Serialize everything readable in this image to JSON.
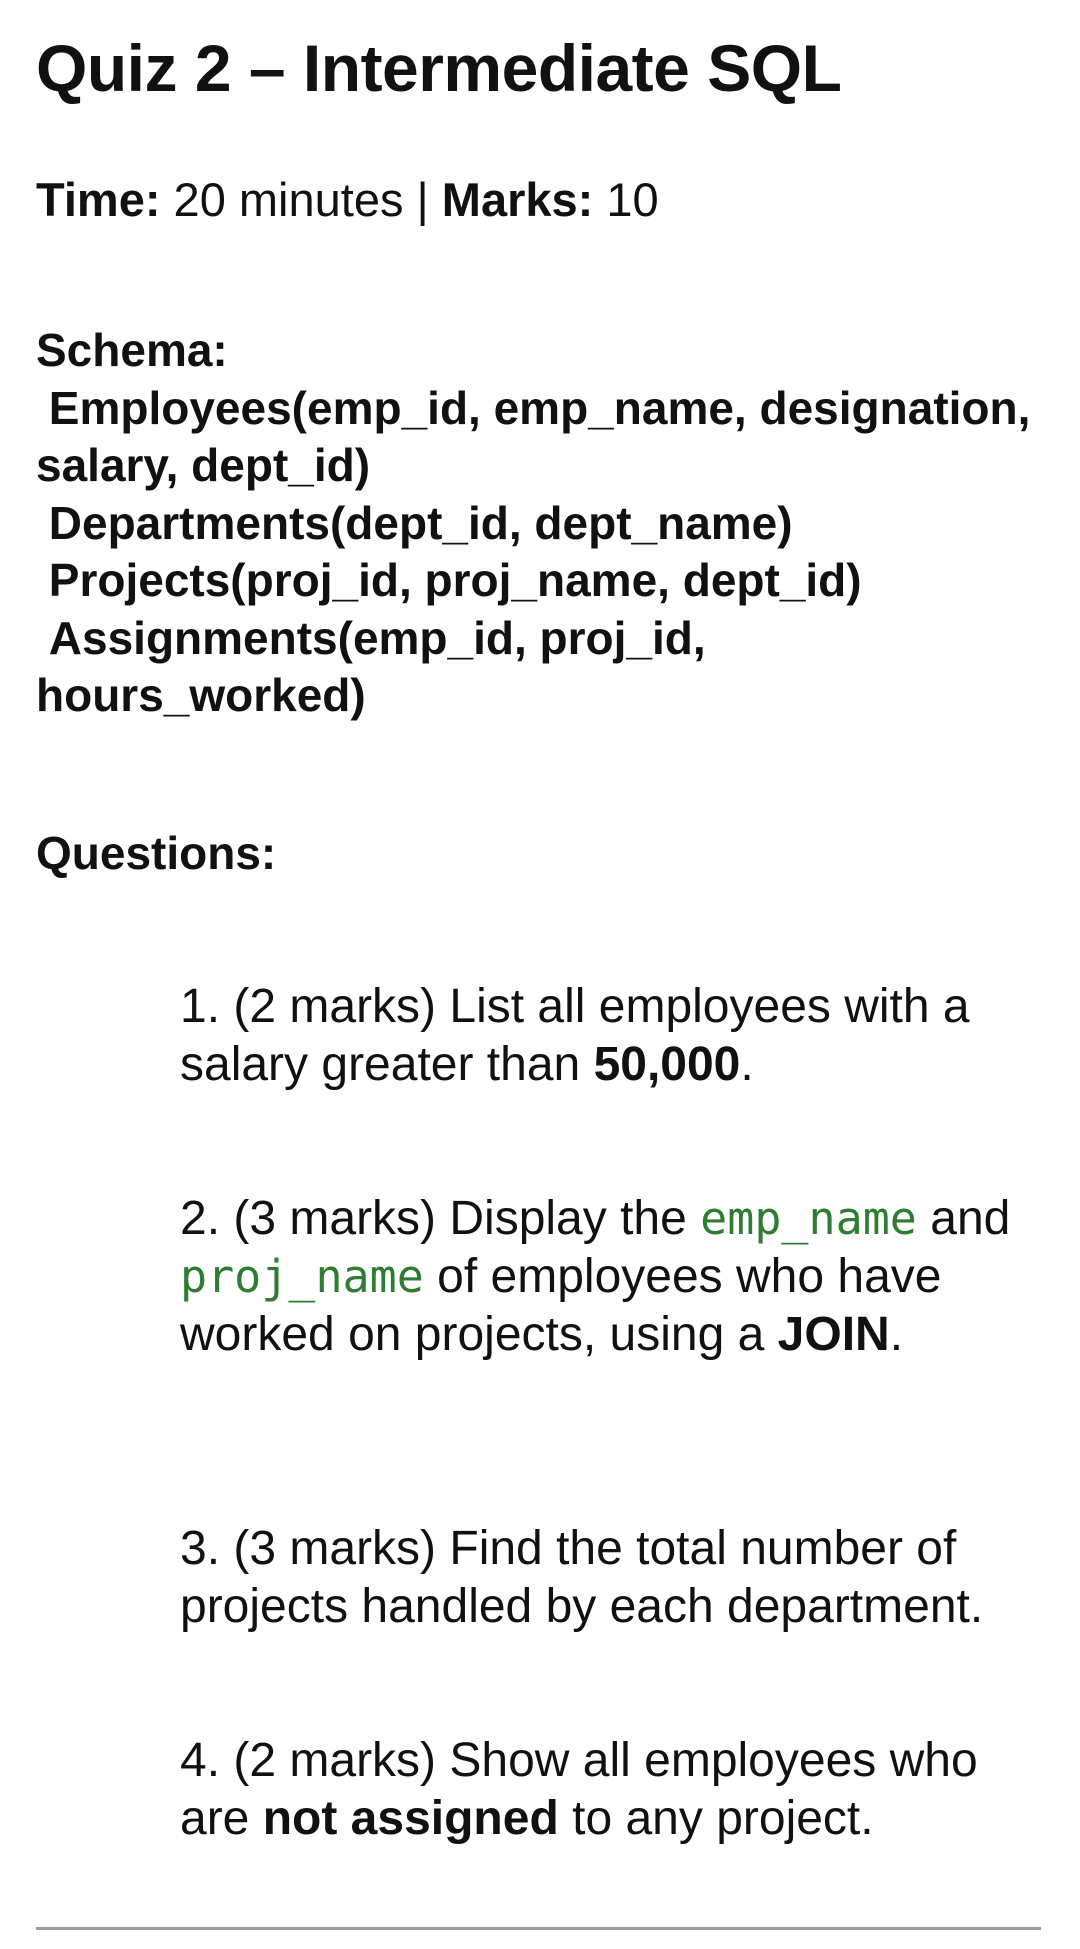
{
  "title": "Quiz 2 – Intermediate SQL",
  "meta": {
    "time_label": "Time:",
    "time_value": " 20 minutes | ",
    "marks_label": "Marks:",
    "marks_value": " 10"
  },
  "schema": {
    "heading": "Schema:",
    "lines": [
      " Employees(emp_id, emp_name, designation, salary, dept_id)",
      " Departments(dept_id, dept_name)",
      " Projects(proj_id, proj_name, dept_id)",
      " Assignments(emp_id, proj_id, hours_worked)"
    ]
  },
  "questions_heading": "Questions:",
  "questions": [
    {
      "prefix": "1. (2 marks) List all employees with a salary greater than ",
      "bold": "50,000",
      "suffix": "."
    },
    {
      "prefix": "2. (3 marks) Display the ",
      "code1": "emp_name",
      "middle": " and ",
      "code2": "proj_name",
      "after": " of employees who have worked on projects, using a ",
      "bold": "JOIN",
      "suffix": "."
    },
    {
      "text": "3. (3 marks) Find the total number of projects handled by each department."
    },
    {
      "prefix": "4. (2 marks) Show all employees who are ",
      "bold": "not assigned",
      "suffix": " to any project."
    }
  ],
  "colors": {
    "code_text": "#2e7d32",
    "divider": "#9e9e9e",
    "body_text": "#111111"
  }
}
